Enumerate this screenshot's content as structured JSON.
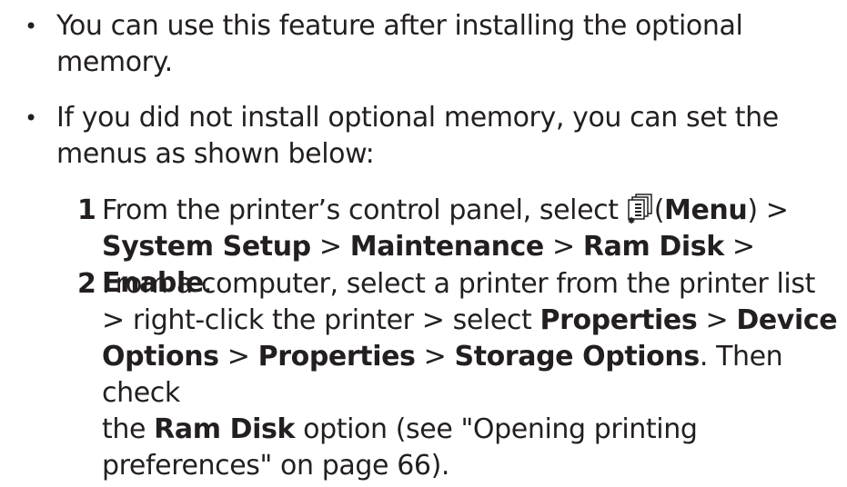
{
  "bullets": [
    {
      "dot": "•",
      "line1": "You can use this feature after installing the optional",
      "line2": "memory."
    },
    {
      "dot": "•",
      "line1": "If you did not install optional memory, you can set the",
      "line2": "menus as shown below:"
    }
  ],
  "steps": [
    {
      "number": "1",
      "line1_prefix": "From the printer’s control panel, select ",
      "icon": "menu-icon",
      "paren_open": "(",
      "menu": "Menu",
      "paren_close": ") >",
      "path_system_setup": "System Setup",
      "sep": " > ",
      "path_maintenance": "Maintenance",
      "path_ram_disk": "Ram Disk",
      "path_enable": "Enable",
      "end": "."
    },
    {
      "number": "2",
      "line1": "From a computer, select a printer from the printer list",
      "line2_prefix": "> right-click the printer > select ",
      "properties": "Properties",
      "sep": " > ",
      "device": "Device",
      "options": "Options",
      "properties2": "Properties",
      "storage_options": "Storage Options",
      "then_check": ". Then check",
      "the": "the ",
      "ram_disk": "Ram Disk",
      "option_text": " option (see \"Opening printing",
      "line5": "preferences\" on page 66)."
    }
  ]
}
